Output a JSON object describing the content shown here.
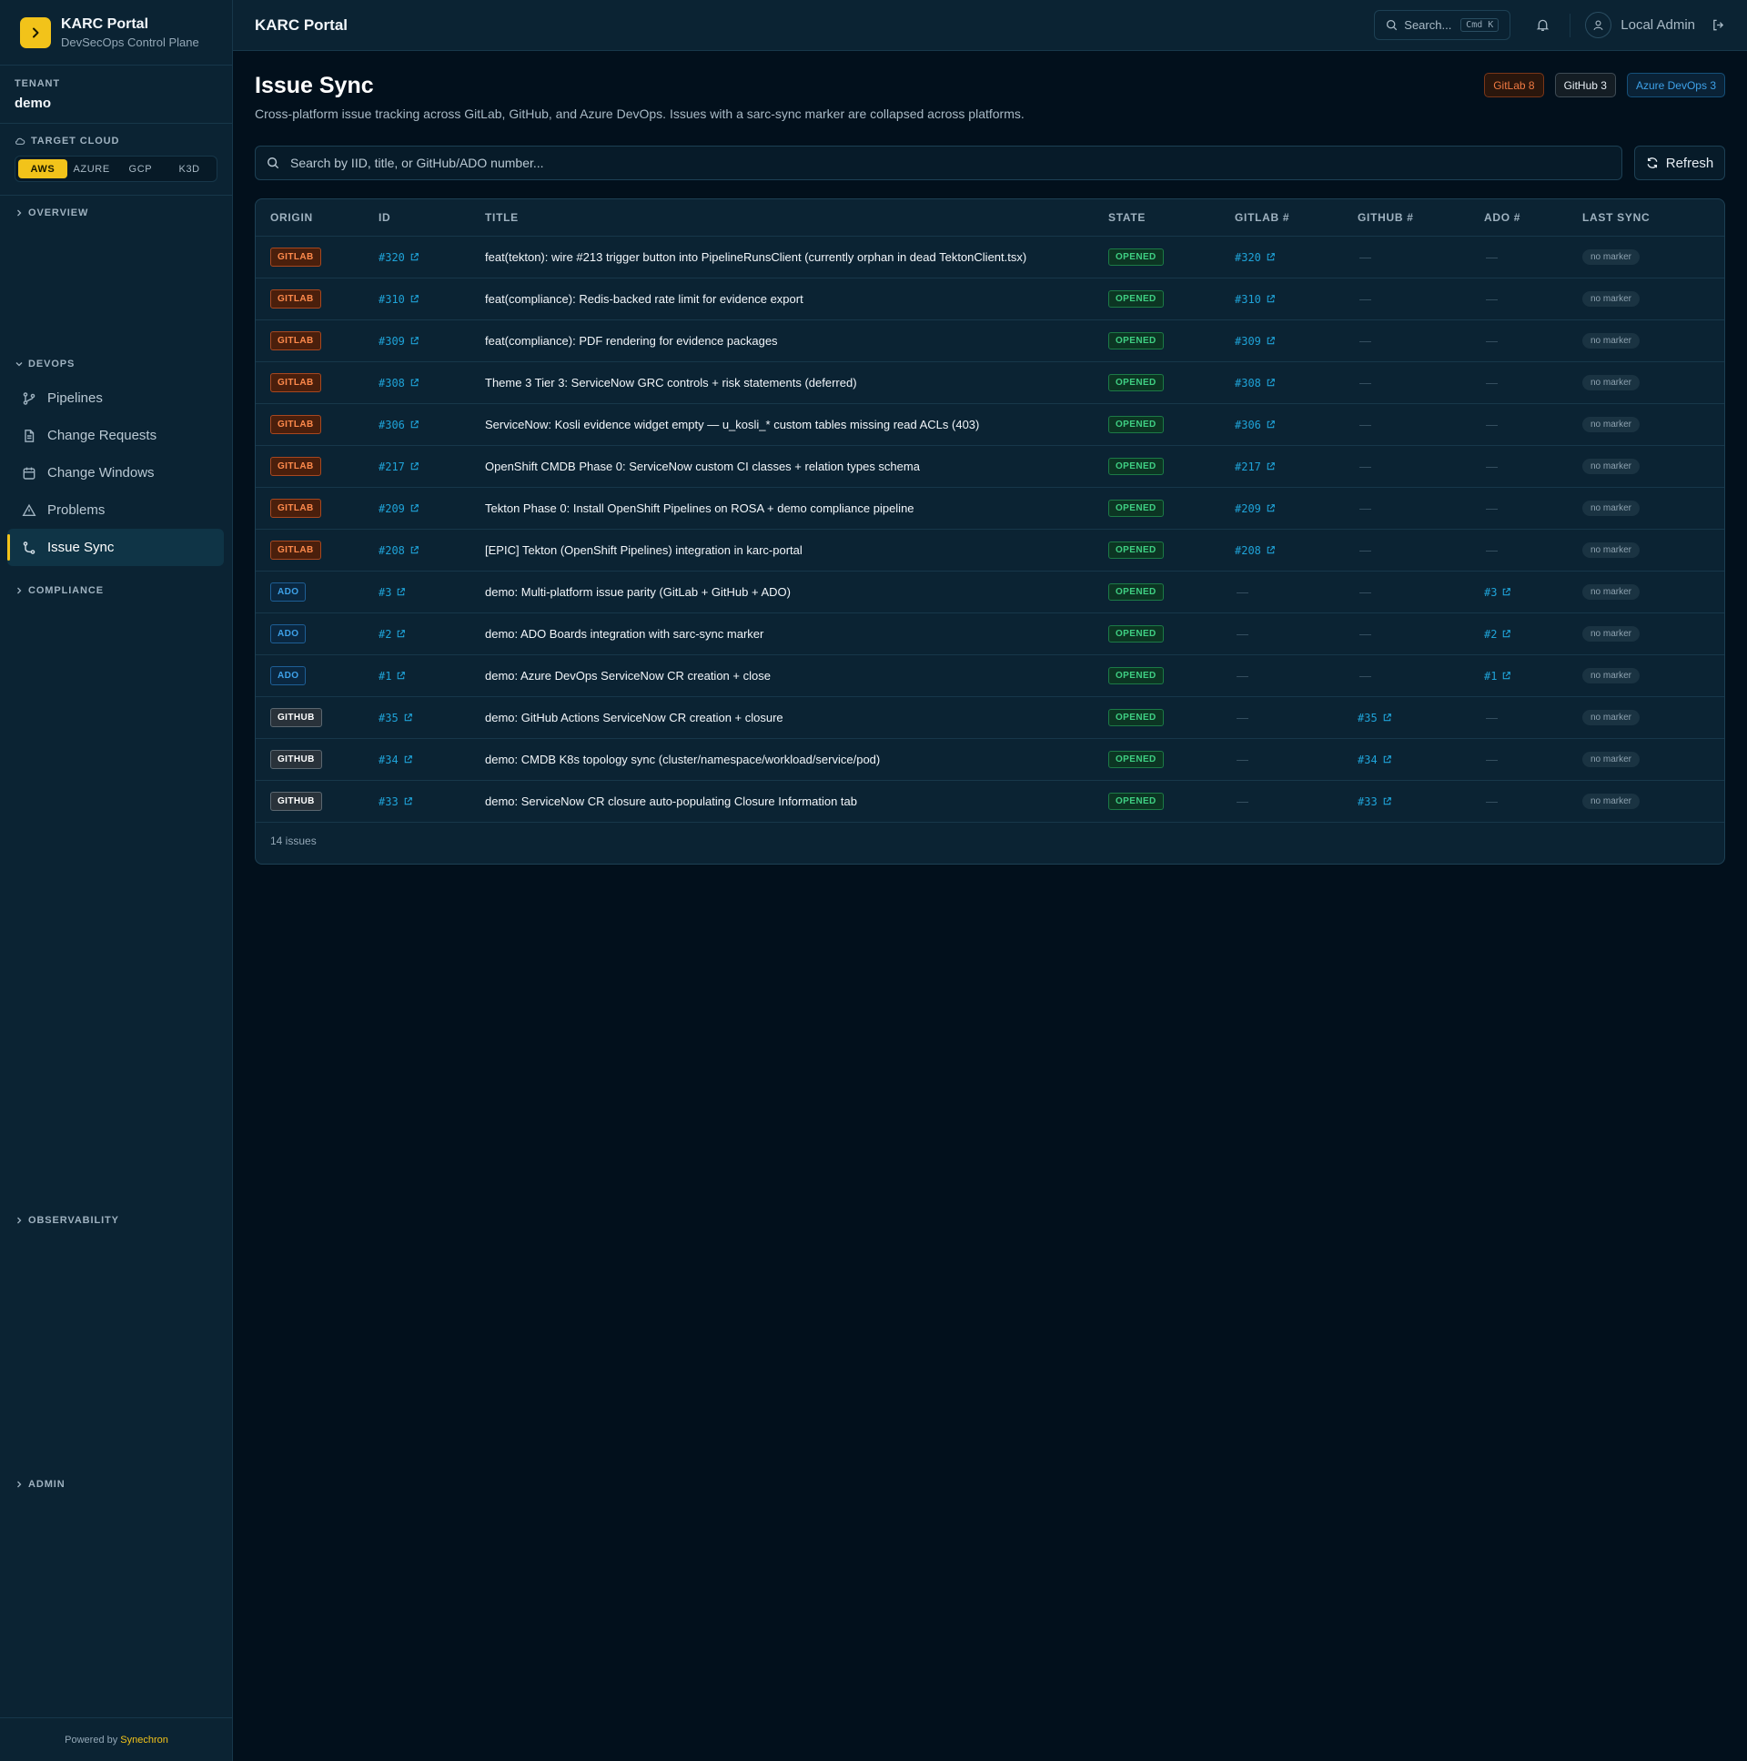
{
  "sidebar": {
    "brand_title": "KARC Portal",
    "brand_subtitle": "DevSecOps Control Plane",
    "tenant_label": "TENANT",
    "tenant_name": "demo",
    "cloud_label": "TARGET CLOUD",
    "clouds": [
      "AWS",
      "AZURE",
      "GCP",
      "K3D"
    ],
    "active_cloud": "AWS",
    "sections": {
      "overview": "OVERVIEW",
      "devops": "DEVOPS",
      "compliance": "COMPLIANCE",
      "observability": "OBSERVABILITY",
      "admin": "ADMIN"
    },
    "devops_items": [
      "Pipelines",
      "Change Requests",
      "Change Windows",
      "Problems",
      "Issue Sync"
    ],
    "active_item": "Issue Sync",
    "footer_prefix": "Powered by",
    "footer_brand": "Synechron",
    "accent_color": "#f2c31a"
  },
  "header": {
    "title": "KARC Portal",
    "search_label": "Search...",
    "search_shortcut": "Cmd K",
    "user_name": "Local Admin"
  },
  "page": {
    "title": "Issue Sync",
    "description": "Cross-platform issue tracking across GitLab, GitHub, and Azure DevOps. Issues with a sarc-sync marker are collapsed across platforms.",
    "counts": {
      "gitlab": "GitLab 8",
      "github": "GitHub 3",
      "ado": "Azure DevOps 3"
    },
    "search_placeholder": "Search by IID, title, or GitHub/ADO number...",
    "refresh_label": "Refresh"
  },
  "table": {
    "columns": {
      "origin": "ORIGIN",
      "id": "ID",
      "title": "TITLE",
      "state": "STATE",
      "gitlab": "GITLAB #",
      "github": "GITHUB #",
      "ado": "ADO #",
      "sync": "LAST SYNC"
    },
    "dash": "—",
    "rows": [
      {
        "origin": "GITLAB",
        "id": "#320",
        "title": "feat(tekton): wire #213 trigger button into PipelineRunsClient (currently orphan in dead TektonClient.tsx)",
        "state": "OPENED",
        "gitlab": "#320",
        "github": "",
        "ado": "",
        "sync": "no marker"
      },
      {
        "origin": "GITLAB",
        "id": "#310",
        "title": "feat(compliance): Redis-backed rate limit for evidence export",
        "state": "OPENED",
        "gitlab": "#310",
        "github": "",
        "ado": "",
        "sync": "no marker"
      },
      {
        "origin": "GITLAB",
        "id": "#309",
        "title": "feat(compliance): PDF rendering for evidence packages",
        "state": "OPENED",
        "gitlab": "#309",
        "github": "",
        "ado": "",
        "sync": "no marker"
      },
      {
        "origin": "GITLAB",
        "id": "#308",
        "title": "Theme 3 Tier 3: ServiceNow GRC controls + risk statements (deferred)",
        "state": "OPENED",
        "gitlab": "#308",
        "github": "",
        "ado": "",
        "sync": "no marker"
      },
      {
        "origin": "GITLAB",
        "id": "#306",
        "title": "ServiceNow: Kosli evidence widget empty — u_kosli_* custom tables missing read ACLs (403)",
        "state": "OPENED",
        "gitlab": "#306",
        "github": "",
        "ado": "",
        "sync": "no marker"
      },
      {
        "origin": "GITLAB",
        "id": "#217",
        "title": "OpenShift CMDB Phase 0: ServiceNow custom CI classes + relation types schema",
        "state": "OPENED",
        "gitlab": "#217",
        "github": "",
        "ado": "",
        "sync": "no marker"
      },
      {
        "origin": "GITLAB",
        "id": "#209",
        "title": "Tekton Phase 0: Install OpenShift Pipelines on ROSA + demo compliance pipeline",
        "state": "OPENED",
        "gitlab": "#209",
        "github": "",
        "ado": "",
        "sync": "no marker"
      },
      {
        "origin": "GITLAB",
        "id": "#208",
        "title": "[EPIC] Tekton (OpenShift Pipelines) integration in karc-portal",
        "state": "OPENED",
        "gitlab": "#208",
        "github": "",
        "ado": "",
        "sync": "no marker"
      },
      {
        "origin": "ADO",
        "id": "#3",
        "title": "demo: Multi-platform issue parity (GitLab + GitHub + ADO)",
        "state": "OPENED",
        "gitlab": "",
        "github": "",
        "ado": "#3",
        "sync": "no marker"
      },
      {
        "origin": "ADO",
        "id": "#2",
        "title": "demo: ADO Boards integration with sarc-sync marker",
        "state": "OPENED",
        "gitlab": "",
        "github": "",
        "ado": "#2",
        "sync": "no marker"
      },
      {
        "origin": "ADO",
        "id": "#1",
        "title": "demo: Azure DevOps ServiceNow CR creation + close",
        "state": "OPENED",
        "gitlab": "",
        "github": "",
        "ado": "#1",
        "sync": "no marker"
      },
      {
        "origin": "GITHUB",
        "id": "#35",
        "title": "demo: GitHub Actions ServiceNow CR creation + closure",
        "state": "OPENED",
        "gitlab": "",
        "github": "#35",
        "ado": "",
        "sync": "no marker"
      },
      {
        "origin": "GITHUB",
        "id": "#34",
        "title": "demo: CMDB K8s topology sync (cluster/namespace/workload/service/pod)",
        "state": "OPENED",
        "gitlab": "",
        "github": "#34",
        "ado": "",
        "sync": "no marker"
      },
      {
        "origin": "GITHUB",
        "id": "#33",
        "title": "demo: ServiceNow CR closure auto-populating Closure Information tab",
        "state": "OPENED",
        "gitlab": "",
        "github": "#33",
        "ado": "",
        "sync": "no marker"
      }
    ],
    "footer": "14 issues"
  }
}
